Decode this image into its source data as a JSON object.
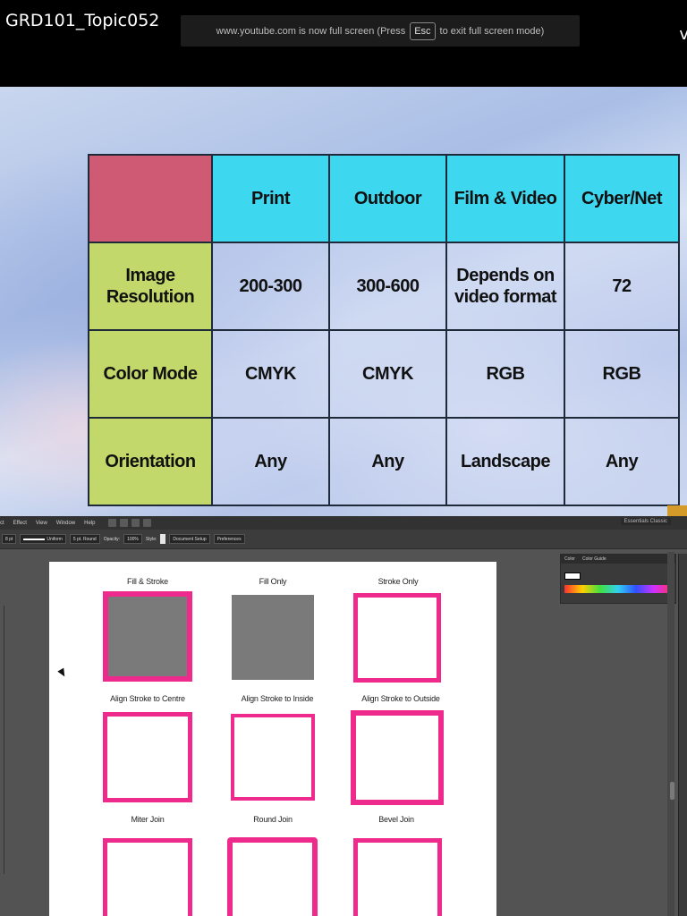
{
  "top": {
    "video_title": "GRD101_Topic052",
    "fullscreen_notice_prefix": "www.youtube.com is now full screen (Press",
    "esc_key": "Esc",
    "fullscreen_notice_suffix": "to exit full screen mode)",
    "right_char": "v"
  },
  "slide_table": {
    "headers": [
      "Print",
      "Outdoor",
      "Film & Video",
      "Cyber/Net"
    ],
    "rows": [
      {
        "label": "Image Resolution",
        "cells": [
          "200-300",
          "300-600",
          "Depends on video format",
          "72"
        ]
      },
      {
        "label": "Color Mode",
        "cells": [
          "CMYK",
          "CMYK",
          "RGB",
          "RGB"
        ]
      },
      {
        "label": "Orientation",
        "cells": [
          "Any",
          "Any",
          "Landscape",
          "Any"
        ]
      }
    ],
    "colors": {
      "corner": "#cf5a74",
      "header": "#3ed7f0",
      "row_header": "#c2d86a"
    }
  },
  "illustrator": {
    "menu": [
      "ct",
      "Effect",
      "View",
      "Window",
      "Help"
    ],
    "workspace": "Essentials Classic",
    "control": {
      "stroke_weight": "8 pt",
      "profile": "Uniform",
      "brush": "5 pt. Round",
      "opacity_label": "Opacity:",
      "opacity": "100%",
      "style_label": "Style:",
      "document_setup": "Document Setup",
      "preferences": "Preferences"
    },
    "panel": {
      "tab1": "Color",
      "tab2": "Color Guide"
    },
    "stroke_color": "#ee2a8c",
    "fill_color": "#7a7a7a",
    "labels": {
      "fill_stroke": "Fill & Stroke",
      "fill_only": "Fill Only",
      "stroke_only": "Stroke Only",
      "align_centre": "Align  Stroke to Centre",
      "align_inside": "Align Stroke to Inside",
      "align_outside": "Align Stroke to Outside",
      "miter": "Miter Join",
      "round": "Round Join",
      "bevel": "Bevel Join"
    }
  }
}
